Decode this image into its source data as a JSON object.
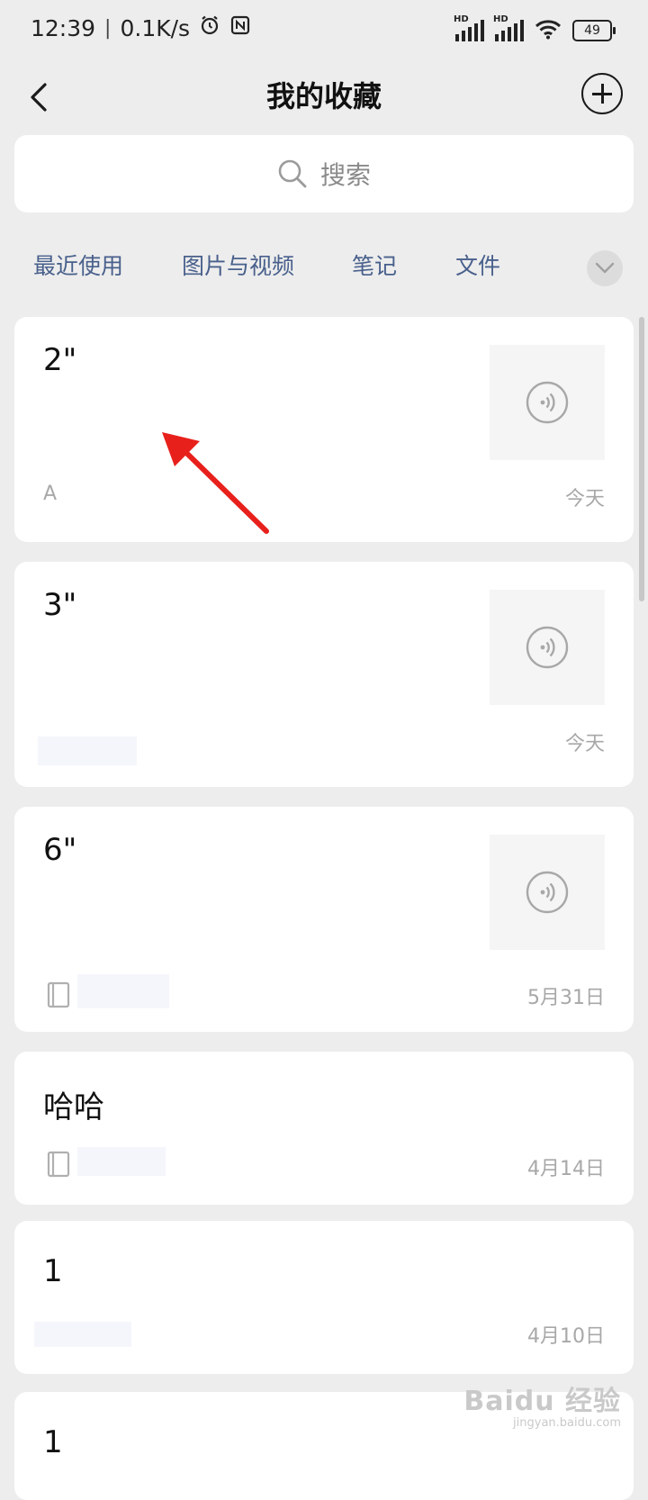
{
  "status_bar": {
    "time": "12:39",
    "speed": "0.1K/s",
    "sim_labels": [
      "HD",
      "HD"
    ],
    "battery": "49"
  },
  "header": {
    "title": "我的收藏"
  },
  "search": {
    "placeholder": "搜索"
  },
  "tabs": [
    "最近使用",
    "图片与视频",
    "笔记",
    "文件"
  ],
  "cards": [
    {
      "title": "2\"",
      "tag": "A",
      "date": "今天",
      "thumb_icon": "voice-icon"
    },
    {
      "title": "3\"",
      "tag": "",
      "date": "今天",
      "thumb_icon": "voice-icon"
    },
    {
      "title": "6\"",
      "tag": "",
      "date": "5月31日",
      "thumb_icon": "voice-icon",
      "source_icon": "note-book-icon"
    },
    {
      "title": "哈哈",
      "tag": "",
      "date": "4月14日",
      "source_icon": "note-book-icon"
    },
    {
      "title": "1",
      "tag": "",
      "date": "4月10日"
    },
    {
      "title": "1",
      "tag": "",
      "date": ""
    }
  ],
  "watermark": {
    "brand": "Baidu 经验",
    "url": "jingyan.baidu.com"
  },
  "colors": {
    "accent_tab": "#49608c",
    "annotation_arrow": "#e8201c",
    "background": "#ededed"
  }
}
